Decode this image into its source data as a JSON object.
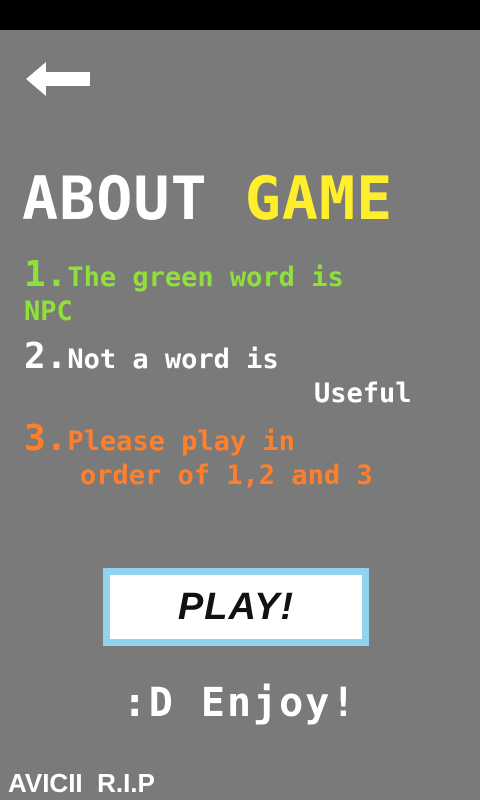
{
  "header": {
    "back_icon": "left-arrow-icon"
  },
  "title": {
    "part1": "ABOUT",
    "part2": "GAME"
  },
  "rules": [
    {
      "number": "1.",
      "line1": "The green word is",
      "line2": "NPC"
    },
    {
      "number": "2.",
      "line1": "Not a word is",
      "line2": "Useful"
    },
    {
      "number": "3.",
      "line1": "Please play in",
      "line2": "order of 1,2 and 3"
    }
  ],
  "play_button": {
    "label": "PLAY!"
  },
  "footer": {
    "enjoy": ":D Enjoy!",
    "credit": "AVICII  R.I.P"
  },
  "colors": {
    "background": "#7a7a7a",
    "green": "#8fe03a",
    "orange": "#ff7f2a",
    "yellow": "#ffee2b",
    "play_border": "#8fd3ee"
  }
}
